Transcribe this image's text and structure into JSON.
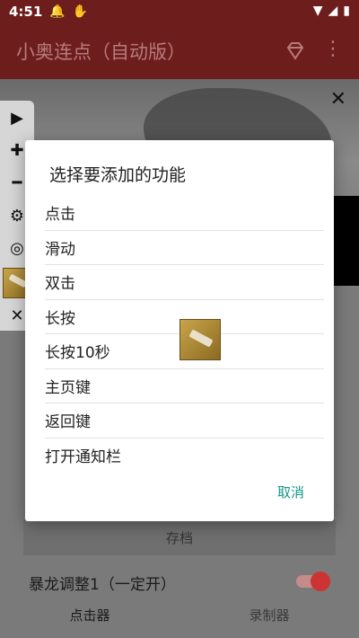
{
  "statusbar": {
    "time": "4:51"
  },
  "appbar": {
    "title": "小奥连点（自动版）"
  },
  "dialog": {
    "title": "选择要添加的功能",
    "items": [
      "点击",
      "滑动",
      "双击",
      "长按",
      "长按10秒",
      "主页键",
      "返回键",
      "打开通知栏"
    ],
    "cancel_label": "取消"
  },
  "background": {
    "archive_label": "存档",
    "row_label": "暴龙调整1（一定开）"
  },
  "bottom_nav": {
    "tabs": [
      "点击器",
      "录制器"
    ]
  },
  "colors": {
    "appbar": "#6e1d1d",
    "accent_teal": "#159488",
    "toggle_red": "#cc3333"
  }
}
